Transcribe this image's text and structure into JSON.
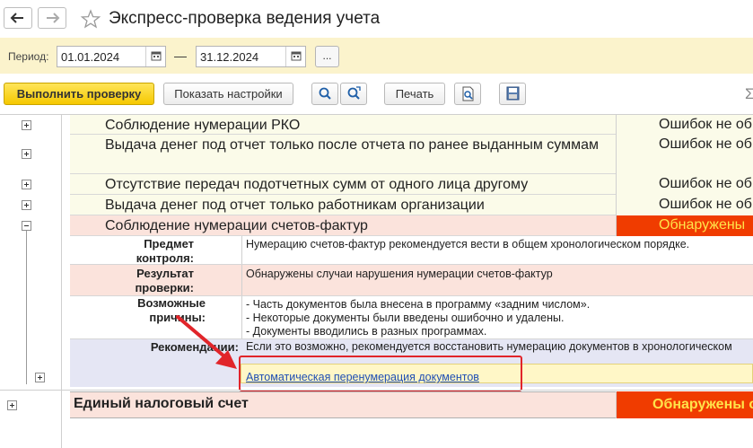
{
  "window": {
    "title": "Экспресс-проверка ведения учета"
  },
  "period": {
    "label": "Период:",
    "start": "01.01.2024",
    "separator": "—",
    "end": "31.12.2024",
    "more_label": "..."
  },
  "toolbar": {
    "run_label": "Выполнить проверку",
    "settings_label": "Показать настройки",
    "print_label": "Печать",
    "sigma": "Σ"
  },
  "rows": [
    {
      "name": "Соблюдение нумерации РКО",
      "status": "Ошибок не обн"
    },
    {
      "name": "Выдача денег под отчет только после отчета по ранее выданным суммам",
      "status": "Ошибок не обн"
    },
    {
      "name": "Отсутствие передач подотчетных сумм от одного лица другому",
      "status": "Ошибок не обн"
    },
    {
      "name": "Выдача денег под отчет только работникам организации",
      "status": "Ошибок не обн"
    },
    {
      "name": "Соблюдение нумерации счетов-фактур",
      "status": "Обнаружены"
    }
  ],
  "detail": {
    "subject_label": "Предмет контроля:",
    "subject_text": "Нумерацию счетов-фактур рекомендуется вести в общем хронологическом порядке.",
    "result_label": "Результат проверки:",
    "result_text": "Обнаружены случаи нарушения нумерации счетов-фактур",
    "causes_label": "Возможные причины:",
    "causes": [
      "- Часть документов была внесена в программу «задним числом».",
      "- Некоторые документы были введены ошибочно и удалены.",
      "- Документы вводились в разных программах."
    ],
    "recommend_label": "Рекомендации:",
    "recommend_text": "Если это возможно, рекомендуется восстановить нумерацию документов в хронологическом",
    "action_link": "Автоматическая перенумерация документов"
  },
  "group": {
    "name": "Единый налоговый счет",
    "status": "Обнаружены о"
  },
  "colors": {
    "accent_yellow": "#f5c800",
    "error_red": "#f03c00",
    "period_bg": "#fbf3cc",
    "highlight_red": "#e1252a"
  }
}
